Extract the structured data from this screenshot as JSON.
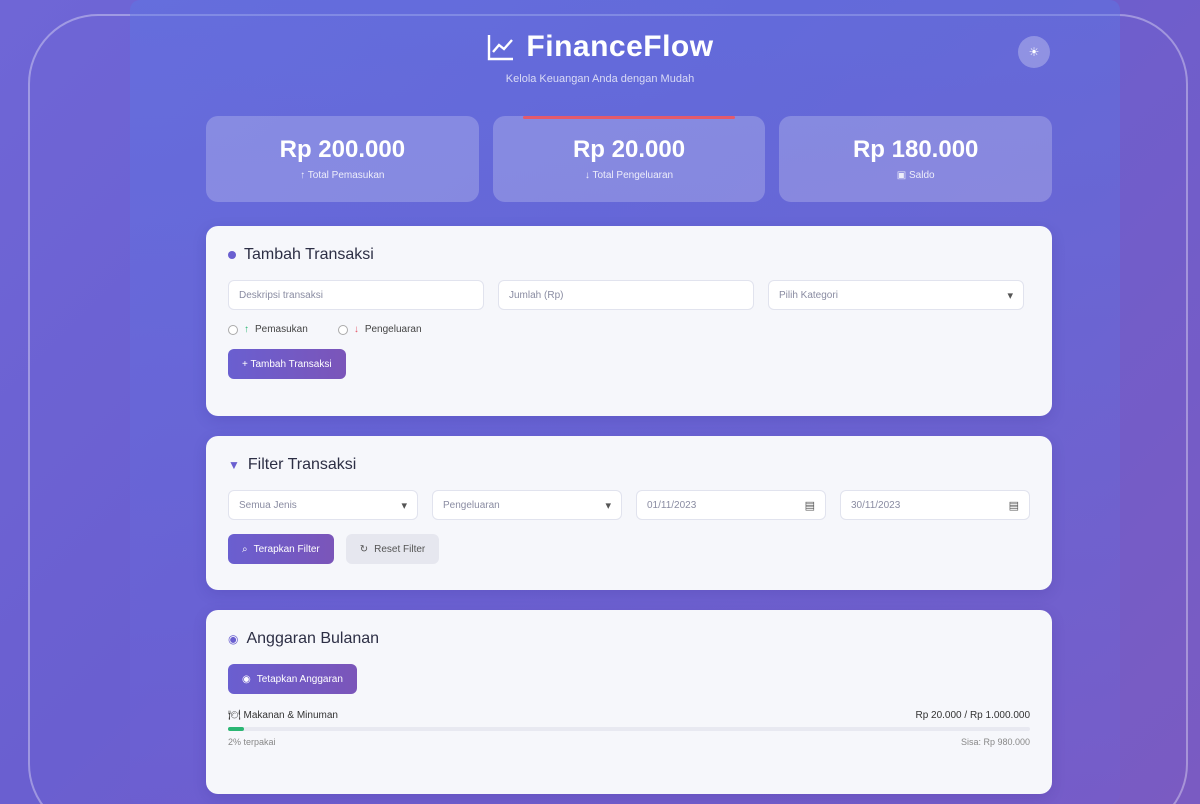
{
  "app": {
    "title": "FinanceFlow",
    "subtitle": "Kelola Keuangan Anda dengan Mudah",
    "theme_toggle": "☀"
  },
  "stats": [
    {
      "amount": "Rp 200.000",
      "label": "Total Pemasukan",
      "icon": "arrow-up-icon"
    },
    {
      "amount": "Rp 20.000",
      "label": "Total Pengeluaran",
      "icon": "arrow-down-icon",
      "accent": "#e45a6b"
    },
    {
      "amount": "Rp 180.000",
      "label": "Saldo",
      "icon": "wallet-icon"
    }
  ],
  "add_transaction": {
    "title": "Tambah Transaksi",
    "description_placeholder": "Deskripsi transaksi",
    "amount_placeholder": "Jumlah (Rp)",
    "category_placeholder": "Pilih Kategori",
    "radio_income": "Pemasukan",
    "radio_expense": "Pengeluaran",
    "submit_label": "+ Tambah Transaksi"
  },
  "filter": {
    "title": "Filter Transaksi",
    "type_select": "Semua Jenis",
    "category_select": "Pengeluaran",
    "date_from": "01/11/2023",
    "date_to": "30/11/2023",
    "apply_label": "Terapkan Filter",
    "reset_label": "Reset Filter"
  },
  "budget": {
    "title": "Anggaran Bulanan",
    "set_label": "Tetapkan Anggaran",
    "item_name": "Makanan & Minuman",
    "item_amount": "Rp 20.000 / Rp 1.000.000",
    "used_text": "2% terpakai",
    "remaining_text": "Sisa: Rp 980.000",
    "used_fraction": 0.02
  },
  "colors": {
    "accent": "#6a5fd0",
    "expense": "#e45a6b",
    "progress": "#2bb673"
  }
}
